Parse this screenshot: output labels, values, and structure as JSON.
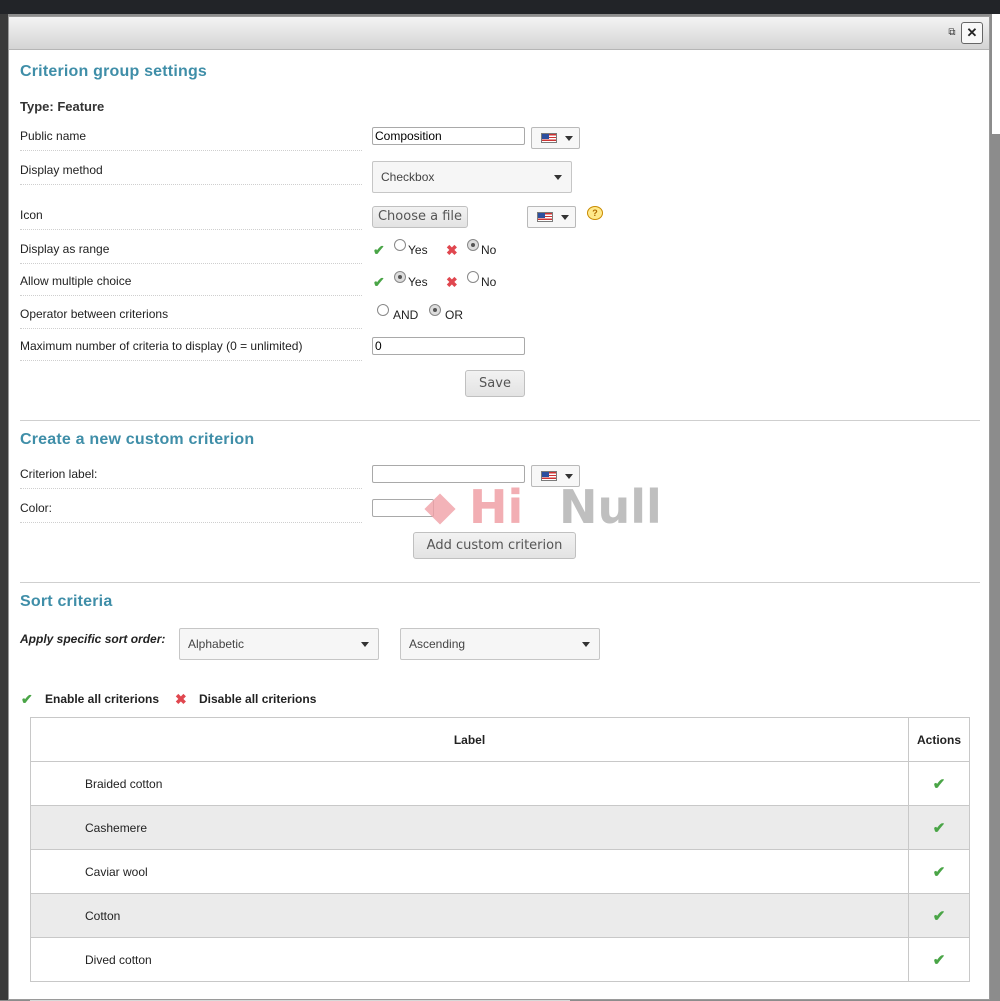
{
  "modal": {
    "restore_icon": "restore-window-icon",
    "close_label": "✕"
  },
  "group_settings": {
    "title": "Criterion group settings",
    "type_label": "Type: Feature",
    "public_name": {
      "label": "Public name",
      "value": "Composition"
    },
    "display_method": {
      "label": "Display method",
      "value": "Checkbox"
    },
    "icon": {
      "label": "Icon",
      "button": "Choose a file",
      "help_glyph": "?"
    },
    "display_as_range": {
      "label": "Display as range",
      "yes": "Yes",
      "no": "No",
      "selected": "No"
    },
    "allow_multiple": {
      "label": "Allow multiple choice",
      "yes": "Yes",
      "no": "No",
      "selected": "Yes"
    },
    "operator": {
      "label": "Operator between criterions",
      "and": "AND",
      "or": "OR",
      "selected": "OR"
    },
    "max_criteria": {
      "label": "Maximum number of criteria to display (0 = unlimited)",
      "value": "0"
    },
    "save_button": "Save"
  },
  "custom_criterion": {
    "title": "Create a new custom criterion",
    "label_field": {
      "label": "Criterion label:",
      "value": ""
    },
    "color_field": {
      "label": "Color:",
      "value": ""
    },
    "add_button": "Add custom criterion"
  },
  "sort": {
    "title": "Sort criteria",
    "apply_label": "Apply specific sort order:",
    "order_by": "Alphabetic",
    "direction": "Ascending",
    "enable_all": "Enable all criterions",
    "disable_all": "Disable all criterions"
  },
  "table": {
    "columns": [
      "Label",
      "Actions"
    ],
    "rows": [
      {
        "label": "Braided cotton",
        "enabled": true
      },
      {
        "label": "Cashemere",
        "enabled": true
      },
      {
        "label": "Caviar wool",
        "enabled": true
      },
      {
        "label": "Cotton",
        "enabled": true
      },
      {
        "label": "Dived cotton",
        "enabled": true
      }
    ]
  },
  "watermark": {
    "part1": "Hi",
    "part2": "Null"
  },
  "glyphs": {
    "check": "✔",
    "cross": "✖"
  },
  "colors": {
    "accent": "#3f8ea8",
    "check": "#4aa547",
    "cross": "#e0474f"
  }
}
